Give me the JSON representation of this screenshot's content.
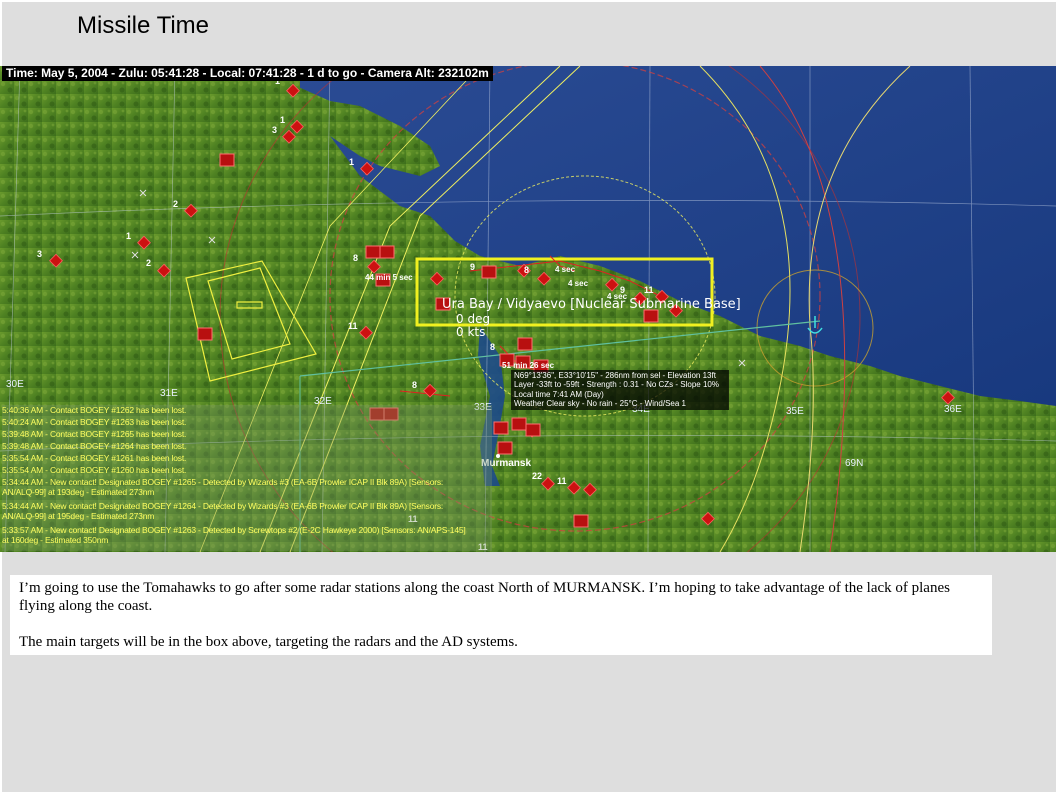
{
  "slide": {
    "title": "Missile Time"
  },
  "status_bar": "Time: May 5, 2004 - Zulu: 05:41:28 - Local: 07:41:28 - 1 d to go -  Camera Alt: 232102m",
  "map": {
    "city": "Murmansk",
    "lon_labels": [
      "30E",
      "31E",
      "32E",
      "33E",
      "34E",
      "35E",
      "36E"
    ],
    "lat_label": "69N",
    "unit_numbers": [
      "1",
      "1",
      "3",
      "1",
      "2",
      "1",
      "2",
      "3",
      "8",
      "9",
      "8",
      "11",
      "8",
      "11",
      "9",
      "8",
      "22",
      "11",
      "11",
      "11"
    ],
    "timers": [
      "44 min 5 sec",
      "4 sec",
      "4 sec",
      "4 sec",
      "51 min 26 sec"
    ],
    "selected_base": {
      "name": "Ura Bay / Vidyaevo [Nuclear Submarine Base]",
      "heading": "0 deg",
      "speed": "0 kts"
    },
    "info_box": [
      "N69°13'36\", E33°10'15\" - 286nm from sel - Elevation 13ft",
      "Layer -33ft to -59ft - Strength : 0.31 - No CZs - Slope 10%",
      "Local time 7:41 AM (Day)",
      "Weather Clear sky - No rain - 25°C - Wind/Sea 1"
    ]
  },
  "message_log": [
    "5:40:36 AM - Contact BOGEY #1262 has been lost.",
    "5:40:24 AM - Contact BOGEY #1263 has been lost.",
    "5:39:48 AM - Contact BOGEY #1265 has been lost.",
    "5:39:48 AM - Contact BOGEY #1264 has been lost.",
    "5:35:54 AM - Contact BOGEY #1261 has been lost.",
    "5:35:54 AM - Contact BOGEY #1260 has been lost.",
    "5:34:44 AM - New contact! Designated BOGEY #1265 - Detected by Wizards #3 (EA-6B Prowler ICAP II Blk 89A)  [Sensors:",
    "AN/ALQ-99] at 193deg - Estimated 273nm",
    "5:34:44 AM - New contact! Designated BOGEY #1264 - Detected by Wizards #3 (EA-6B Prowler ICAP II Blk 89A)  [Sensors:",
    "AN/ALQ-99] at 195deg - Estimated 273nm",
    "5:33:57 AM - New contact! Designated BOGEY #1263 - Detected by Screwtops #2 (E-2C Hawkeye 2000)  [Sensors: AN/APS-145]",
    "at 160deg - Estimated 350nm"
  ],
  "body_text": [
    "I’m going to use the Tomahawks to go after some radar stations along the coast North of MURMANSK.  I’m hoping to take advantage of the lack of planes flying along the coast.",
    "The main targets will be in the box above, targeting the radars and the AD systems."
  ],
  "colors": {
    "land": "#5a8a2a",
    "sea": "#1c3f86",
    "hostile": "#cc1111",
    "selection_box": "#f0f020"
  }
}
